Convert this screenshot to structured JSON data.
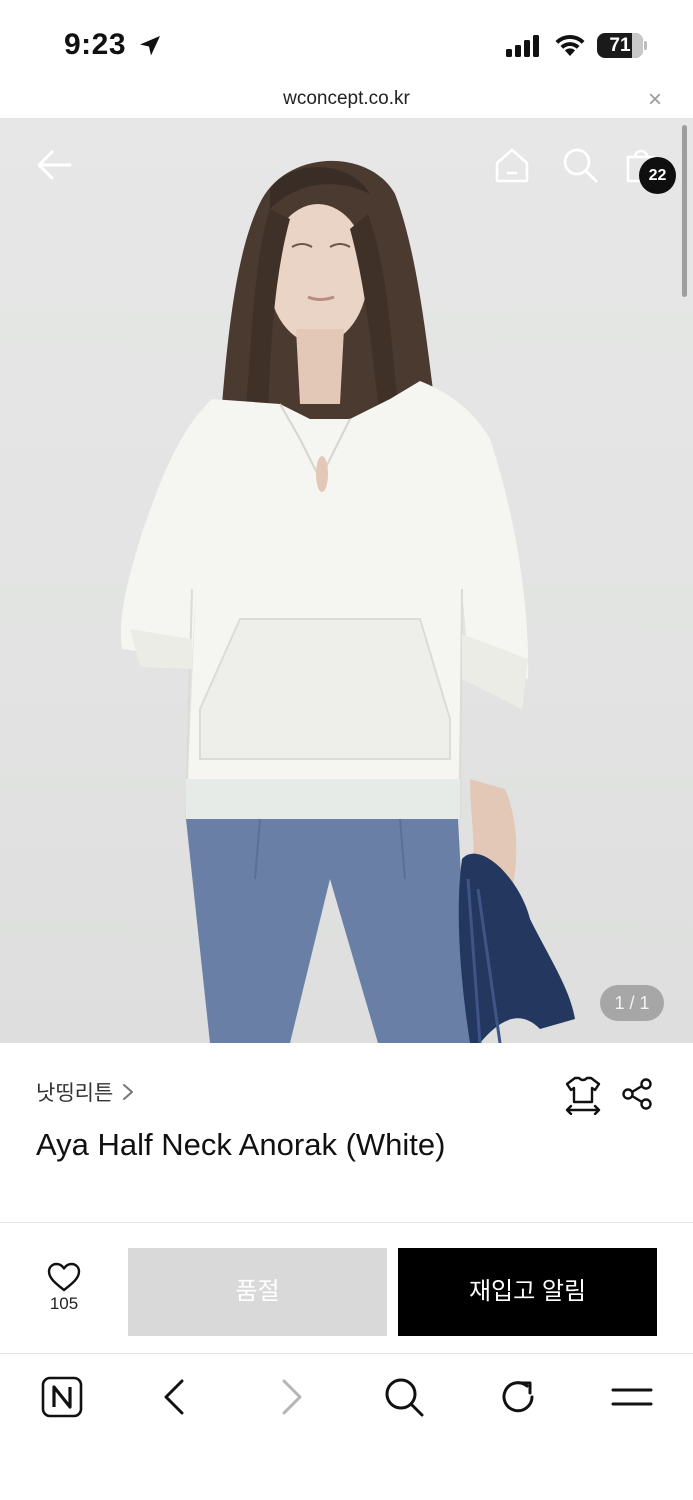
{
  "status_bar": {
    "time": "9:23",
    "battery": "71"
  },
  "url_bar": {
    "domain": "wconcept.co.kr",
    "close_label": "×"
  },
  "header": {
    "cart_count": "22"
  },
  "gallery": {
    "counter": "1 / 1"
  },
  "product": {
    "brand": "낫띵리튼",
    "title": "Aya Half Neck Anorak (White)"
  },
  "purchase": {
    "wish_count": "105",
    "soldout_label": "품절",
    "restock_label": "재입고 알림"
  },
  "icons": {
    "back": "arrow-left-icon",
    "home": "home-icon",
    "search": "search-icon",
    "cart": "shopping-bag-icon",
    "size": "size-guide-icon",
    "share": "share-icon",
    "wish": "heart-icon",
    "naver": "naver-n-icon",
    "nav_back": "chevron-left-icon",
    "nav_forward": "chevron-right-icon",
    "refresh": "refresh-icon",
    "menu": "hamburger-menu-icon"
  },
  "colors": {
    "primary_button": "#000000",
    "disabled_button": "#d9d9d9",
    "badge": "#0f0f0f"
  }
}
